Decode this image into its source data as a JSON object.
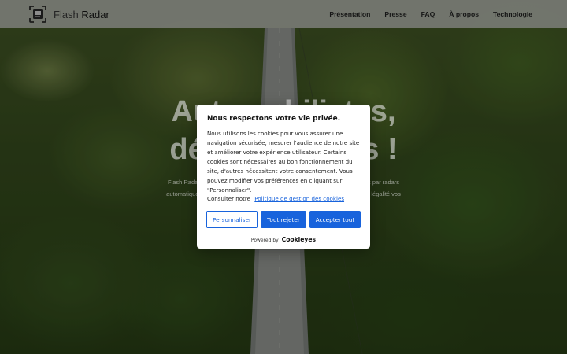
{
  "header": {
    "logo_thin": "Flash",
    "logo_bold": "Radar",
    "nav": [
      "Présentation",
      "Presse",
      "FAQ",
      "À propos",
      "Technologie"
    ]
  },
  "hero": {
    "title_line1": "Automobilistes,",
    "title_line2": "défendez-vous !",
    "subtitle_line1": "Flash Radar est l'application qui vous aide à contester les infractions relevées par radars",
    "subtitle_line2": "automatiques, vidéo-verbalisation et autres dispositifs, pour défendre en toute légalité vos"
  },
  "cookie": {
    "title": "Nous respectons votre vie privée.",
    "body": "Nous utilisons les cookies pour vous assurer une navigation sécurisée, mesurer l'audience de notre site et améliorer votre expérience utilisateur. Certains cookies sont nécessaires au bon fonctionnement du site, d'autres nécessitent votre consentement. Vous pouvez modifier vos préférences en cliquant sur \"Personnaliser\".",
    "consult_label": "Consulter notre",
    "policy_link": "Politique de gestion des cookies",
    "btn_customize": "Personnaliser",
    "btn_reject": "Tout rejeter",
    "btn_accept": "Accepter tout",
    "powered_by": "Powered by",
    "brand": "Cookieyes"
  },
  "colors": {
    "accent": "#1863dc",
    "header_bg": "#a0a0a0"
  },
  "icons": {
    "logo": "radar-frame-icon"
  }
}
